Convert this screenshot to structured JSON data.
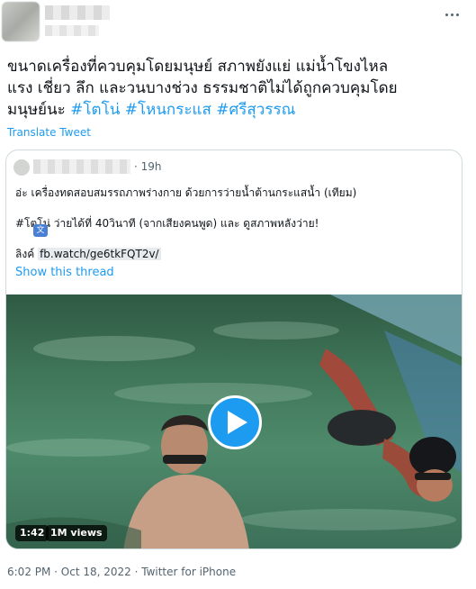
{
  "tweet": {
    "text_line1": "ขนาดเครื่องที่ควบคุมโดยมนุษย์ สภาพยังแย่ แม่น้ำโขงไหล",
    "text_line2": "แรง เชี่ยว ลึก และวนบางช่วง ธรรมชาติไม่ได้ถูกควบคุมโดย",
    "text_line3_prefix": "มนุษย์นะ",
    "hashtags": [
      "#โตโน่",
      "#โหนกระแส",
      "#ศรีสุวรรณ"
    ],
    "translate_label": "Translate Tweet",
    "footer": "6:02 PM · Oct 18, 2022 · Twitter for iPhone"
  },
  "quote": {
    "time": "· 19h",
    "line1": "อ่ะ เครื่องทดสอบสมรรถภาพร่างกาย  ด้วยการว่ายน้ำต้านกระแสน้ำ (เทียม)",
    "line2": "#โตโน่ ว่ายได้ที่ 40วินาที (จากเสียงคนพูด) และ ดูสภาพหลังว่าย!",
    "link_prefix": "ลิงค์",
    "link": "fb.watch/ge6tkFQT2v/",
    "translate_badge": "文",
    "show_thread": "Show this thread",
    "video": {
      "duration": "1:42",
      "views": "1M views"
    }
  },
  "icons": {
    "more": "more-horizontal-icon",
    "play": "play-icon"
  },
  "colors": {
    "accent": "#1d9bf0",
    "text": "#0f1419",
    "muted": "#536471",
    "border": "#cfd9de"
  }
}
